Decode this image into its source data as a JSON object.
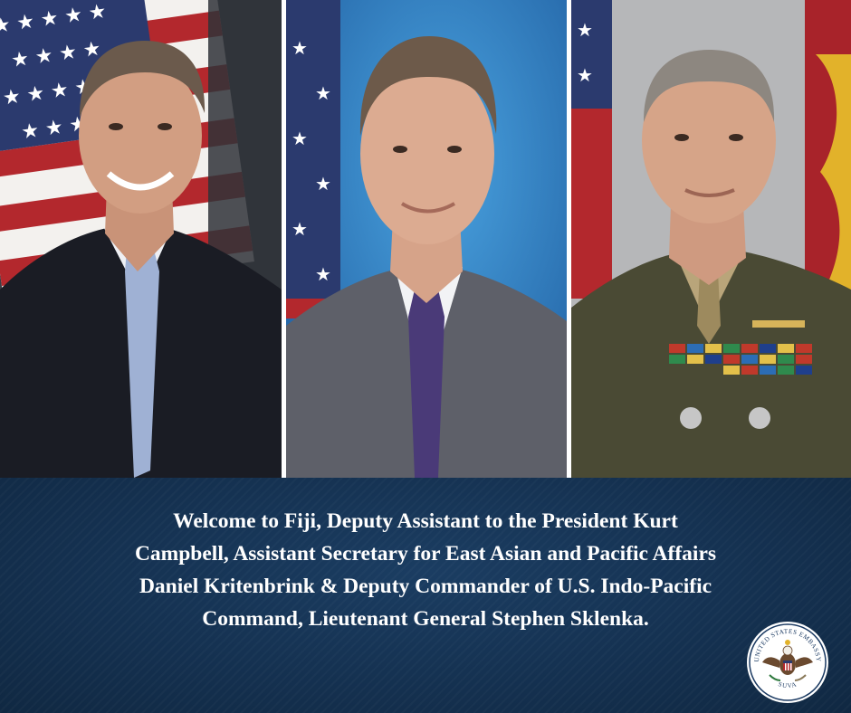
{
  "caption": {
    "lines": [
      "Welcome to Fiji, Deputy Assistant to the President Kurt",
      "Campbell, Assistant Secretary for East Asian and Pacific Affairs",
      "Daniel Kritenbrink & Deputy Commander of U.S. Indo-Pacific",
      "Command, Lieutenant General Stephen Sklenka."
    ]
  },
  "seal": {
    "top_text": "UNITED STATES EMBASSY",
    "bottom_text": "SUVA"
  },
  "colors": {
    "banner": "#14304f",
    "caption_text": "#ffffff",
    "flag_red": "#b3282d",
    "flag_blue": "#2b3a6e",
    "marine_red": "#a8232a",
    "marine_gold": "#e2b22a"
  }
}
